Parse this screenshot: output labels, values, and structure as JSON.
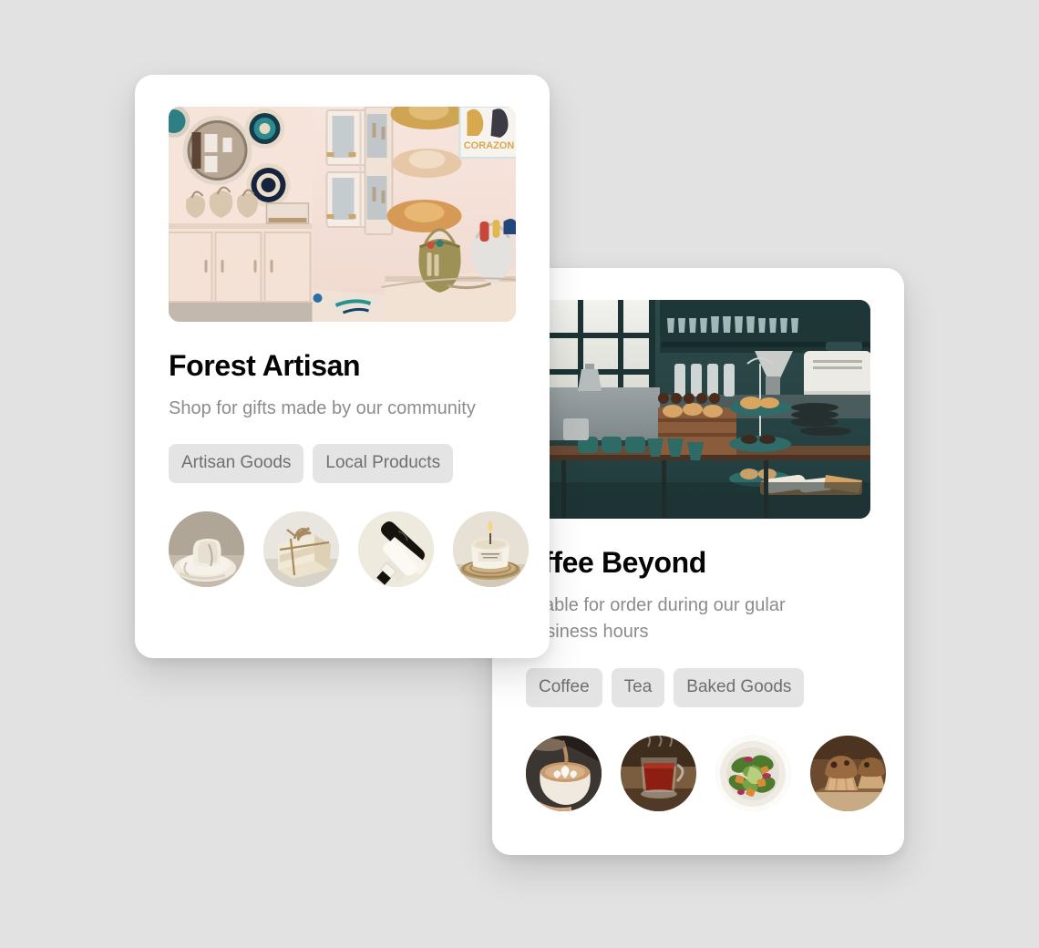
{
  "background_color": "#e2e2e2",
  "cards": [
    {
      "id": "forest-artisan",
      "title": "Forest Artisan",
      "description": "Shop for gifts made by our community",
      "hero_alt": "artisan-boutique-interior",
      "tags": [
        "Artisan Goods",
        "Local Products"
      ],
      "thumbnails": [
        "ceramic-mug-and-plates-thumbnail",
        "soap-bar-with-twine-thumbnail",
        "cosmetic-tube-thumbnail",
        "scented-candle-jar-thumbnail"
      ]
    },
    {
      "id": "coffee-beyond",
      "title": "offee Beyond",
      "description": "ailable for order during our gular business hours",
      "hero_alt": "cafe-counter-with-pastries",
      "tags": [
        "Coffee",
        "Tea",
        "Baked Goods"
      ],
      "thumbnails": [
        "latte-cup-thumbnail",
        "glass-of-tea-thumbnail",
        "salad-bowl-thumbnail",
        "muffins-thumbnail"
      ]
    }
  ],
  "colors": {
    "title": "#050505",
    "description": "#8c8c8c",
    "tag_background": "#e4e4e4",
    "tag_text": "#6f6f6f",
    "card_background": "#ffffff"
  }
}
